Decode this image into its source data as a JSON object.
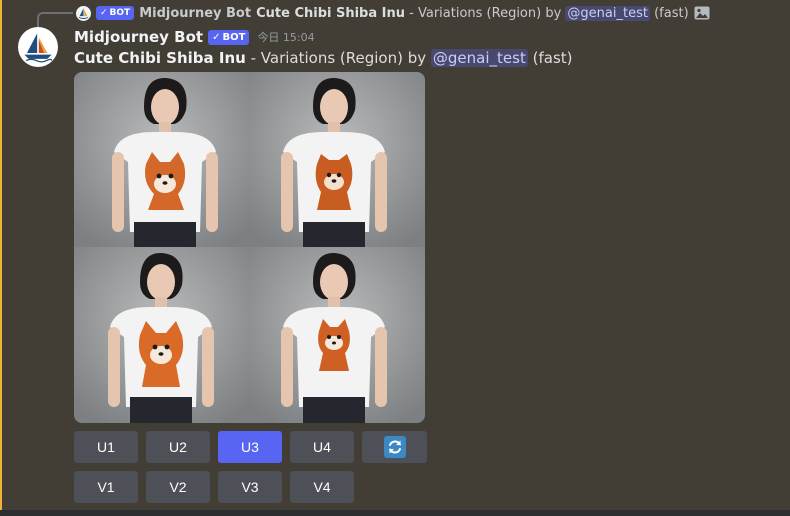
{
  "reply": {
    "bot_badge": "BOT",
    "author": "Midjourney Bot",
    "prompt": "Cute Chibi Shiba Inu",
    "suffix": " - Variations (Region) by ",
    "mention": "@genai_test",
    "speed": "(fast)",
    "image_icon": "image-icon"
  },
  "message": {
    "author": "Midjourney Bot",
    "bot_badge": "BOT",
    "timestamp": "今日 15:04",
    "prompt": "Cute Chibi Shiba Inu",
    "suffix": " - Variations (Region) by ",
    "mention": "@genai_test",
    "speed": "(fast)"
  },
  "images": [
    {
      "alt": "woman in white t-shirt with chibi shiba inu print"
    },
    {
      "alt": "woman in white t-shirt with chibi shiba inu print"
    },
    {
      "alt": "woman in white t-shirt with chibi shiba inu print"
    },
    {
      "alt": "woman in white t-shirt with chibi shiba inu print"
    }
  ],
  "buttons": {
    "upscale": [
      "U1",
      "U2",
      "U3",
      "U4"
    ],
    "variation": [
      "V1",
      "V2",
      "V3",
      "V4"
    ],
    "active": "U3",
    "reroll_icon": "refresh-icon"
  },
  "colors": {
    "background": "#423e36",
    "accent": "#f0b232",
    "button": "#4e5058",
    "button_active": "#5865f2",
    "reroll_icon": "#3b88c3"
  }
}
